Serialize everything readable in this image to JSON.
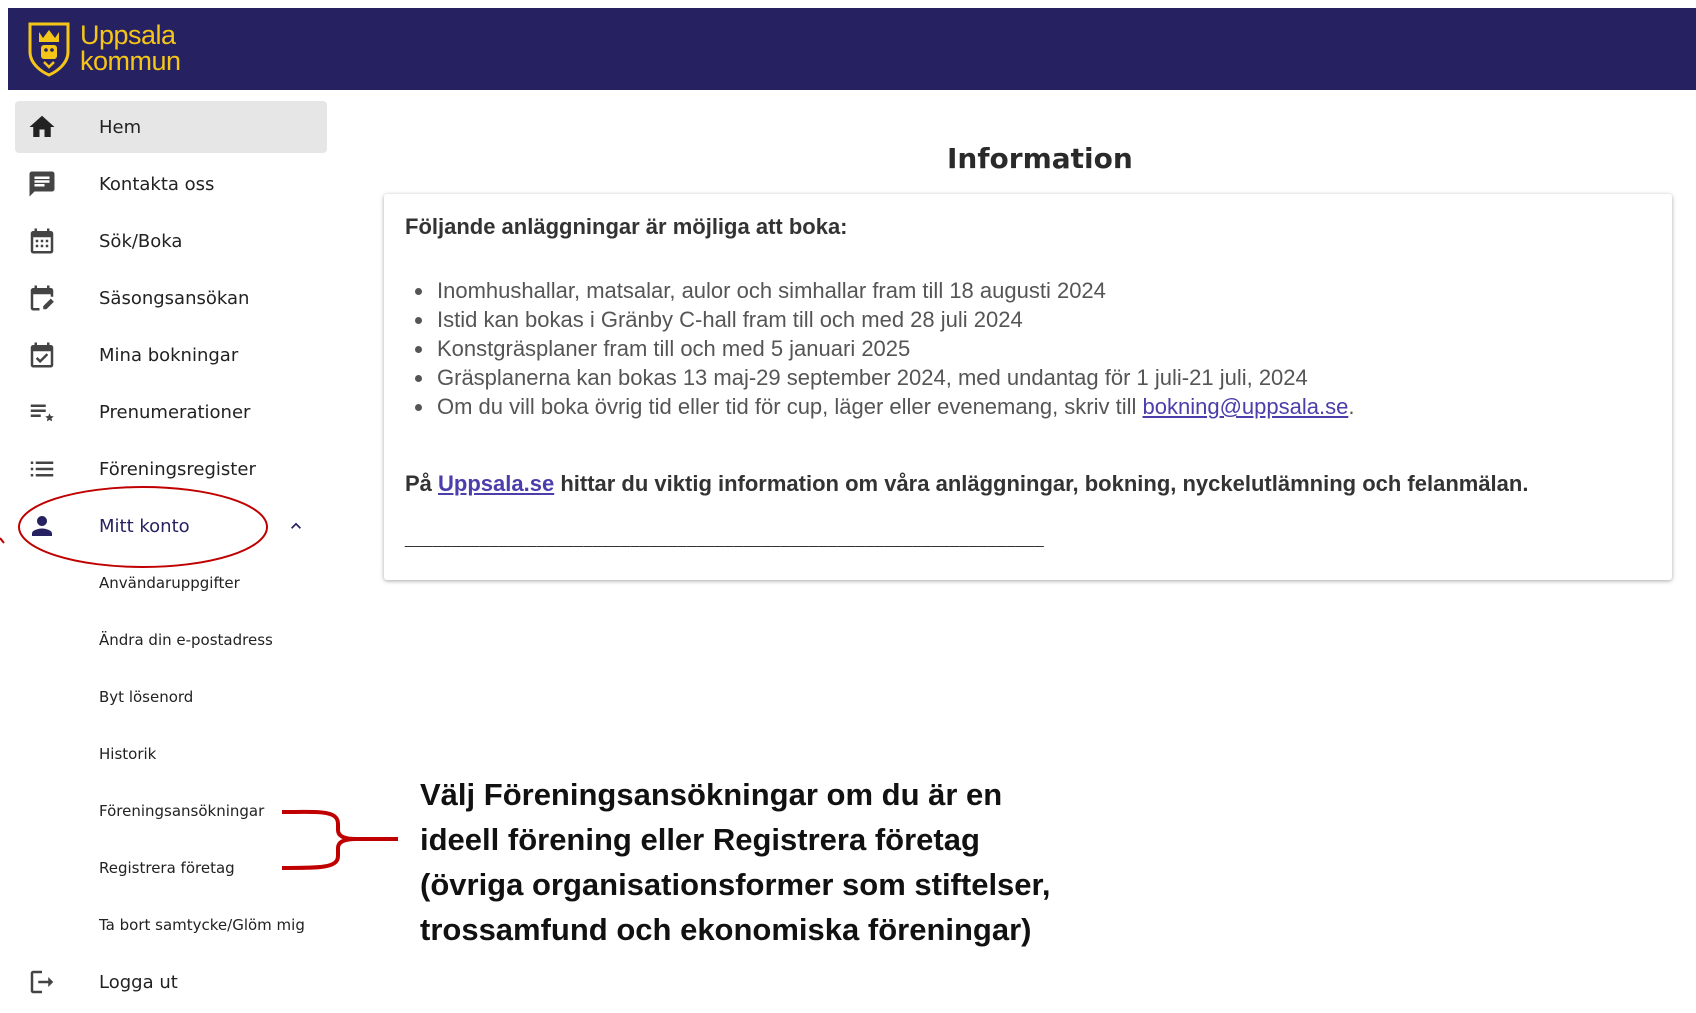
{
  "header": {
    "logo_line1": "Uppsala",
    "logo_line2": "kommun",
    "brand_color": "#262262",
    "logo_color": "#f5c518"
  },
  "sidebar": {
    "items": [
      {
        "label": "Hem",
        "icon": "home-icon",
        "active": true
      },
      {
        "label": "Kontakta oss",
        "icon": "chat-icon"
      },
      {
        "label": "Sök/Boka",
        "icon": "calendar-icon"
      },
      {
        "label": "Säsongsansökan",
        "icon": "calendar-edit-icon"
      },
      {
        "label": "Mina bokningar",
        "icon": "calendar-check-icon"
      },
      {
        "label": "Prenumerationer",
        "icon": "playlist-star-icon"
      },
      {
        "label": "Föreningsregister",
        "icon": "list-icon"
      },
      {
        "label": "Mitt konto",
        "icon": "person-icon",
        "expanded": true
      }
    ],
    "account_subitems": [
      "Användaruppgifter",
      "Ändra din e-postadress",
      "Byt lösenord",
      "Historik",
      "Föreningsansökningar",
      "Registrera företag",
      "Ta bort samtycke/Glöm mig"
    ],
    "logout": {
      "label": "Logga ut",
      "icon": "logout-icon"
    }
  },
  "main": {
    "title": "Information",
    "card": {
      "heading": "Följande anläggningar är möjliga att boka:",
      "bullets": [
        "Inomhushallar, matsalar, aulor och simhallar fram till 18 augusti 2024",
        "Istid kan bokas i Gränby C-hall fram till och med 28 juli 2024",
        "Konstgräsplaner fram till och med 5 januari 2025",
        "Gräsplanerna kan bokas 13 maj-29 september 2024, med undantag för 1 juli-21 juli, 2024"
      ],
      "last_bullet_prefix": "Om du vill boka övrig tid eller tid för cup, läger eller evenemang, skriv till ",
      "email_link": "bokning@uppsala.se",
      "last_bullet_suffix": ".",
      "footer_prefix": "På ",
      "footer_link": "Uppsala.se",
      "footer_suffix": " hittar du viktig information om våra anläggningar, bokning, nyckelutlämning och felanmälan.",
      "divider": "____________________________________________________________________"
    }
  },
  "annotation": {
    "callout_lines": [
      "Välj Föreningsansökningar om du är en",
      "ideell förening eller Registrera företag",
      "(övriga organisationsformer som stiftelser,",
      "trossamfund och ekonomiska föreningar)"
    ],
    "annotation_color": "#c00000"
  }
}
